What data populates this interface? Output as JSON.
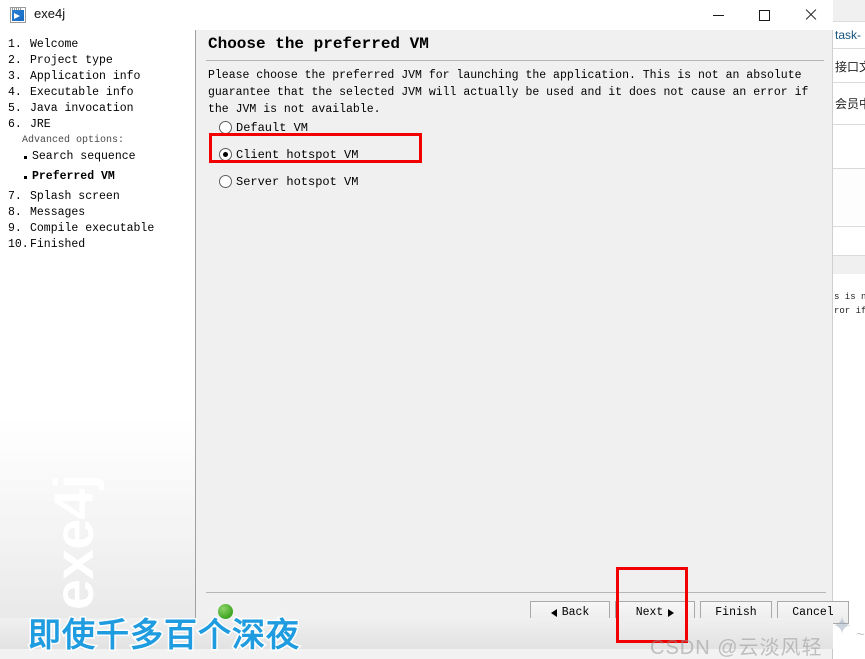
{
  "window": {
    "title": "exe4j",
    "app_icon": "exe4j-icon",
    "controls": {
      "minimize": "minimize-icon",
      "maximize": "maximize-icon",
      "close": "close-icon"
    }
  },
  "sidebar": {
    "steps": [
      {
        "num": "1.",
        "label": "Welcome",
        "kind": "numbered",
        "active": false
      },
      {
        "num": "2.",
        "label": "Project type",
        "kind": "numbered",
        "active": false
      },
      {
        "num": "3.",
        "label": "Application info",
        "kind": "numbered",
        "active": false
      },
      {
        "num": "4.",
        "label": "Executable info",
        "kind": "numbered",
        "active": false
      },
      {
        "num": "5.",
        "label": "Java invocation",
        "kind": "numbered",
        "active": false
      },
      {
        "num": "6.",
        "label": "JRE",
        "kind": "numbered",
        "active": false
      },
      {
        "num": "",
        "label": "Advanced options:",
        "kind": "section",
        "active": false
      },
      {
        "num": "",
        "label": "Search sequence",
        "kind": "bullet",
        "active": false
      },
      {
        "num": "",
        "label": "Preferred VM",
        "kind": "bullet",
        "active": true
      },
      {
        "num": "7.",
        "label": "Splash screen",
        "kind": "numbered",
        "active": false
      },
      {
        "num": "8.",
        "label": "Messages",
        "kind": "numbered",
        "active": false
      },
      {
        "num": "9.",
        "label": "Compile executable",
        "kind": "numbered",
        "active": false
      },
      {
        "num": "10.",
        "label": "Finished",
        "kind": "numbered",
        "active": false
      }
    ],
    "watermark": "exe4j"
  },
  "main": {
    "title": "Choose the preferred VM",
    "description": "Please choose the preferred JVM for launching the application. This is not an absolute guarantee that the selected JVM will actually be used and it does not cause an error if the JVM is not available.",
    "options": [
      {
        "label": "Default VM",
        "selected": false
      },
      {
        "label": "Client hotspot VM",
        "selected": true
      },
      {
        "label": "Server hotspot VM",
        "selected": false
      }
    ]
  },
  "buttons": {
    "back": "Back",
    "next": "Next",
    "finish": "Finish",
    "cancel": "Cancel"
  },
  "annotations": {
    "highlight_option": "Client hotspot VM",
    "highlight_button": "Next",
    "highlight_color": "#f20000"
  },
  "background_window": {
    "line1": "task-",
    "line2": "接口文",
    "line3": "会员中",
    "mono1": "s is n",
    "mono2": "ror if"
  },
  "overlays": {
    "cn_caption": "即使千多百个深夜",
    "csdn": "CSDN @云淡风轻",
    "tilde": "~",
    "star": "✦",
    "caption_color": "#1f9ce0"
  }
}
